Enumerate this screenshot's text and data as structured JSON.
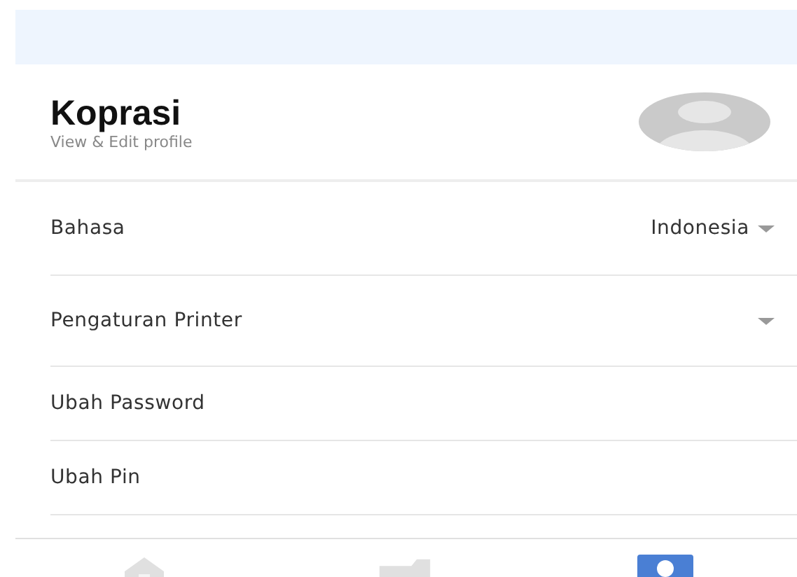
{
  "profile": {
    "name": "Koprasi",
    "subtitle": "View & Edit profile"
  },
  "settings": [
    {
      "kind": "dropdown",
      "label": "Bahasa",
      "value": "Indonesia"
    },
    {
      "kind": "dropdown",
      "label": "Pengaturan Printer"
    },
    {
      "kind": "link",
      "label": "Ubah Password"
    },
    {
      "kind": "link",
      "label": "Ubah Pin"
    }
  ],
  "nav": [
    {
      "kind": "home",
      "selected": false
    },
    {
      "kind": "folder",
      "selected": false
    },
    {
      "kind": "profile",
      "selected": true
    }
  ]
}
